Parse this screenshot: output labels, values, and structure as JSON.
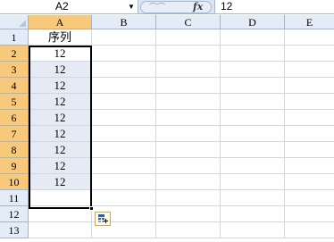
{
  "formula_bar": {
    "name_box": "A2",
    "name_box_arrow": "▼",
    "fx_label": "fx",
    "fx_dots": "⌒⌒",
    "formula_value": "12"
  },
  "columns": [
    "A",
    "B",
    "C",
    "D",
    "E"
  ],
  "rows": [
    "1",
    "2",
    "3",
    "4",
    "5",
    "6",
    "7",
    "8",
    "9",
    "10",
    "11",
    "12",
    "13"
  ],
  "cells": {
    "A1": "序列",
    "A2": "12",
    "A3": "12",
    "A4": "12",
    "A5": "12",
    "A6": "12",
    "A7": "12",
    "A8": "12",
    "A9": "12",
    "A10": "12"
  },
  "selection": {
    "range": "A2:A10",
    "active_cell": "A2",
    "highlight_color": "#f8c97a"
  },
  "icons": {
    "autofill_options": "autofill-options-icon"
  }
}
